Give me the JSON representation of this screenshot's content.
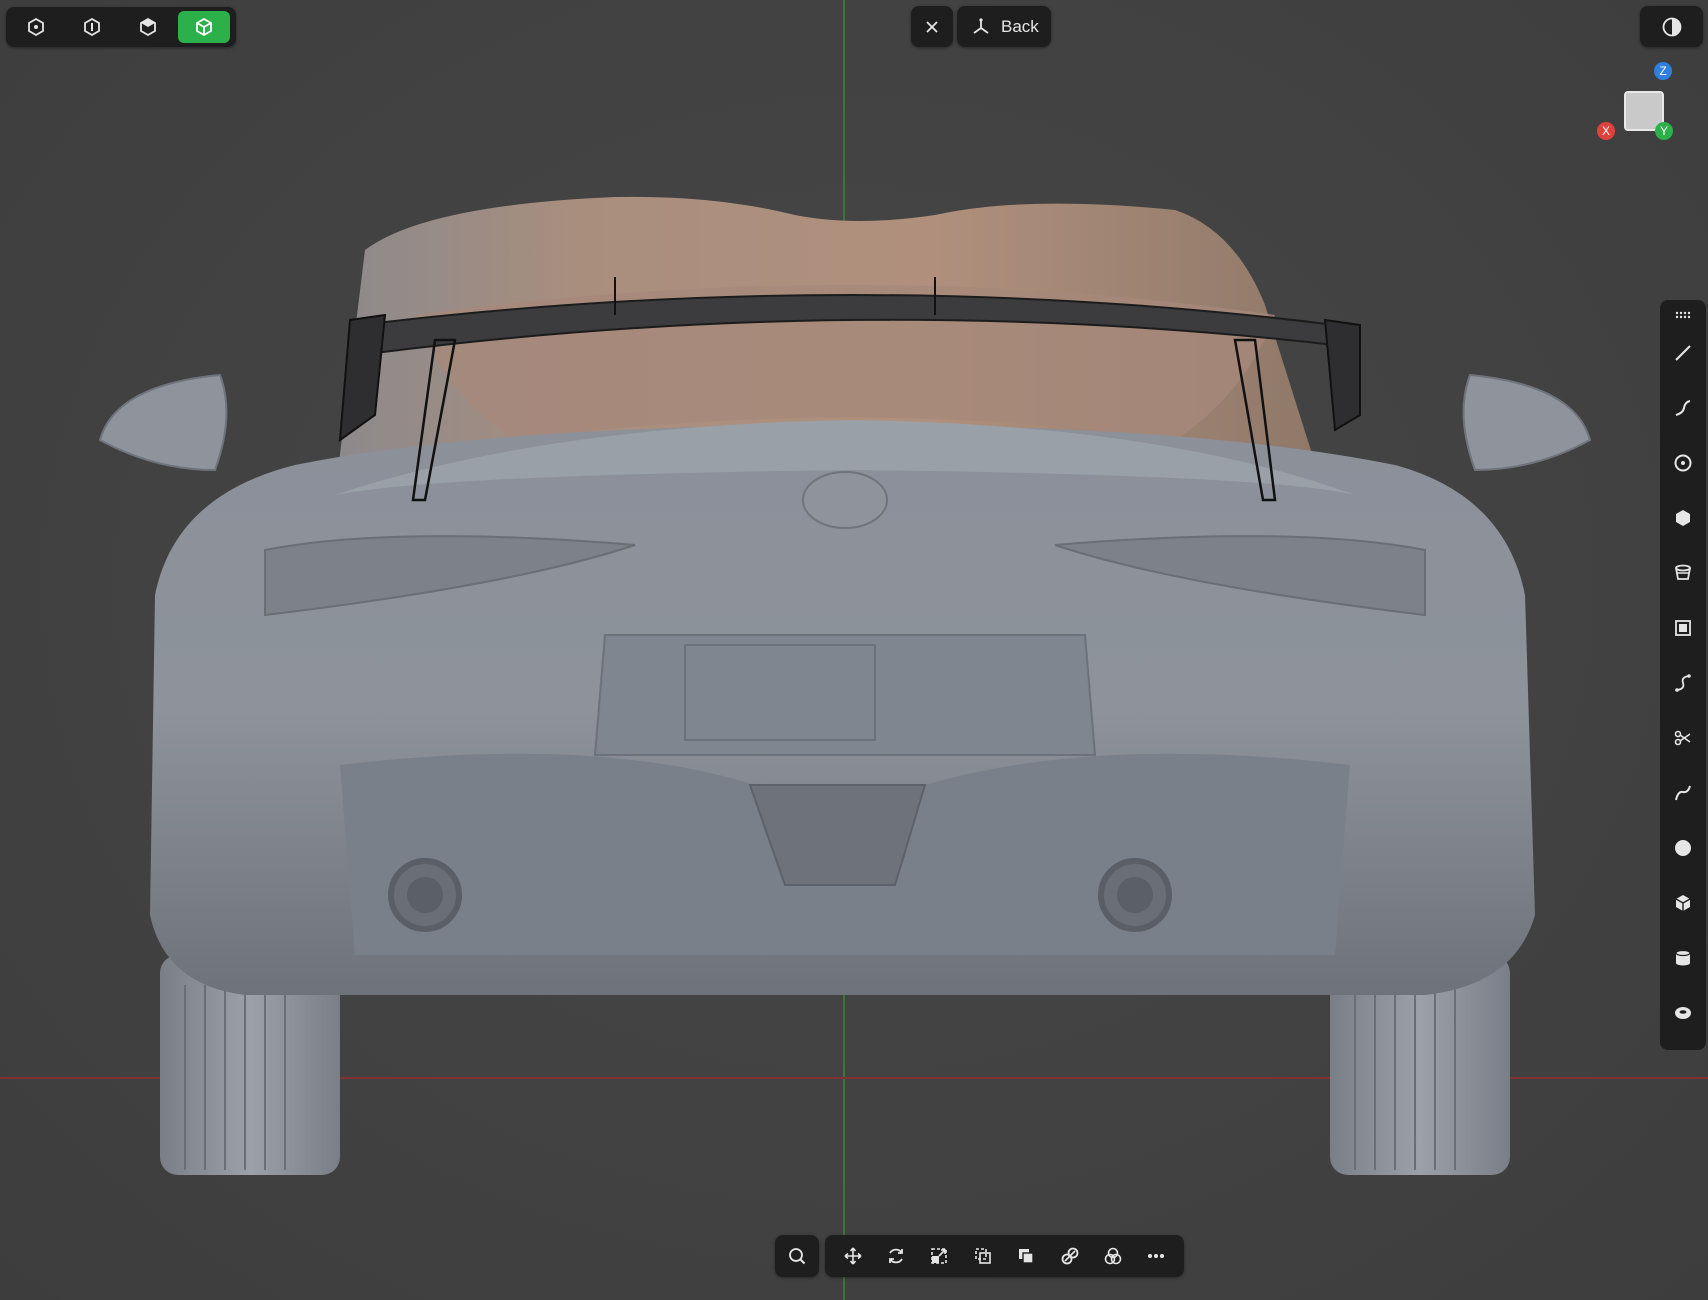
{
  "header": {
    "back_label": "Back"
  },
  "mode_bar": {
    "items": [
      {
        "icon": "vertex-mode-icon",
        "active": false
      },
      {
        "icon": "edge-mode-icon",
        "active": false
      },
      {
        "icon": "face-mode-icon",
        "active": false
      },
      {
        "icon": "object-mode-icon",
        "active": true
      }
    ],
    "active_color": "#2bb04a"
  },
  "gizmo": {
    "x_label": "X",
    "y_label": "Y",
    "z_label": "Z",
    "x_color": "#e0413b",
    "y_color": "#2bb04a",
    "z_color": "#2f7fe0"
  },
  "right_toolbar": {
    "tools": [
      "menu-grid-icon",
      "line-tool-icon",
      "curve-tool-icon",
      "circle-tool-icon",
      "polygon-tool-icon",
      "extrude-tool-icon",
      "box-select-icon",
      "spline-tool-icon",
      "cut-tool-icon",
      "bend-tool-icon",
      "sphere-tool-icon",
      "cube-tool-icon",
      "cylinder-tool-icon",
      "torus-tool-icon"
    ]
  },
  "bottom_toolbar": {
    "tools": [
      "search-icon",
      "move-icon",
      "rotate-icon",
      "scale-icon",
      "duplicate-icon",
      "boolean-icon",
      "link-icon",
      "union-icon",
      "more-icon"
    ]
  },
  "axes": {
    "x_axis_color": "#8a2f2f",
    "y_axis_color": "#3d7a3a"
  }
}
